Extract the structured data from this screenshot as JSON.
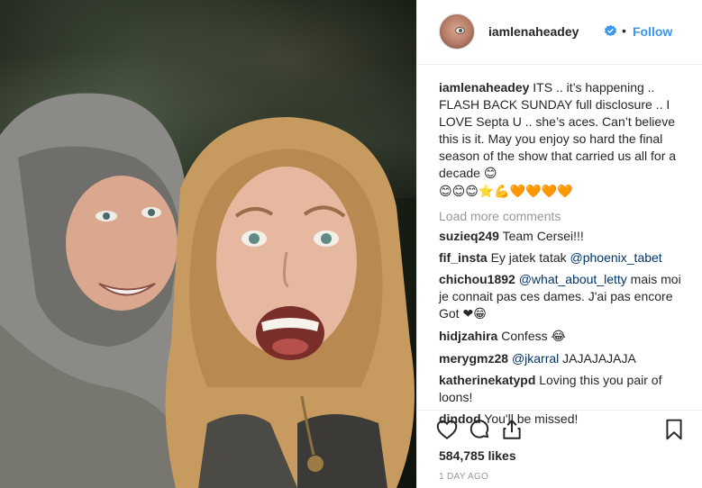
{
  "post": {
    "username": "iamlenaheadey",
    "follow_label": "Follow",
    "separator": "•",
    "caption_user": "iamlenaheadey",
    "caption_text": " ITS .. it’s happening .. FLASH BACK SUNDAY full disclosure .. I LOVE Septa U .. she’s aces. Can’t believe this is it. May you enjoy so hard the final season of the show that carried us all for a decade ",
    "caption_emoji_trailing": "😊",
    "caption_emoji_row": "😊😊😊⭐💪🧡🧡🧡🧡",
    "load_more": "Load more comments",
    "comments": [
      {
        "user": "suzieq249",
        "text": " Team Cersei!!!",
        "mention": "",
        "after": "",
        "emoji": ""
      },
      {
        "user": "fif_insta",
        "text": " Ey jatek tatak ",
        "mention": "@phoenix_tabet",
        "after": "",
        "emoji": ""
      },
      {
        "user": "chichou1892",
        "text": " ",
        "mention": "@what_about_letty",
        "after": " mais moi je connait pas ces dames. J'ai pas encore Got ",
        "emoji": "❤😁"
      },
      {
        "user": "hidjzahira",
        "text": " Confess ",
        "mention": "",
        "after": "",
        "emoji": "😂"
      },
      {
        "user": "merygmz28",
        "text": " ",
        "mention": "@jkarral",
        "after": " JAJAJAJAJA",
        "emoji": ""
      },
      {
        "user": "katherinekatypd",
        "text": " Loving this you pair of loons!",
        "mention": "",
        "after": "",
        "emoji": ""
      },
      {
        "user": "dindod",
        "text": " You'll be missed!",
        "mention": "",
        "after": "",
        "emoji": ""
      }
    ],
    "likes": "584,785 likes",
    "time": "1 DAY AGO"
  },
  "icons": {
    "like": "heart-icon",
    "comment": "comment-bubble-icon",
    "share": "share-icon",
    "save": "bookmark-icon",
    "verified": "verified-badge-icon"
  },
  "colors": {
    "accent": "#3897f0",
    "text": "#262626",
    "muted": "#999999",
    "mention": "#003569",
    "border": "#efefef"
  }
}
